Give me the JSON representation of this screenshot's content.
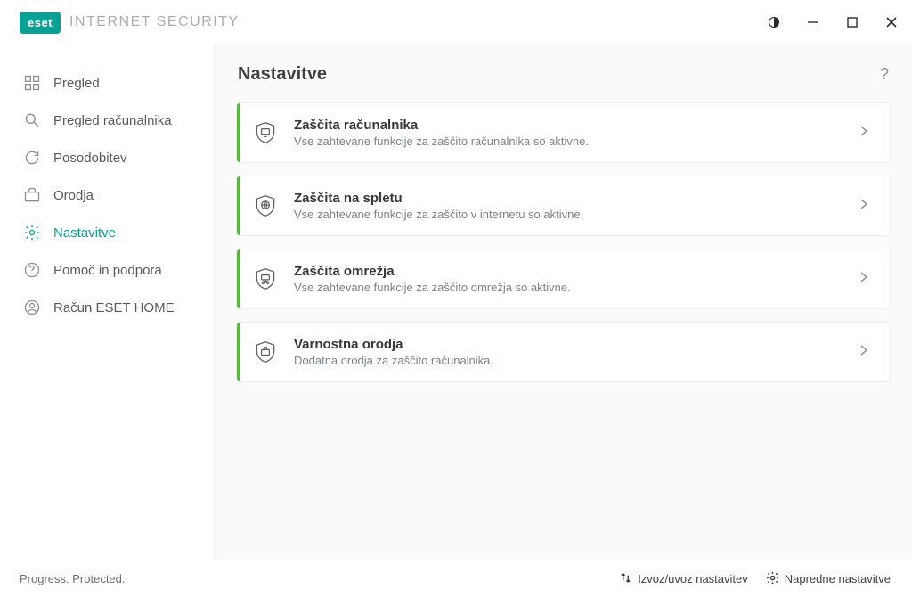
{
  "app": {
    "badge": "eset",
    "product": "INTERNET SECURITY",
    "tagline": "Progress. Protected."
  },
  "sidebar": {
    "items": [
      {
        "label": "Pregled",
        "active": false
      },
      {
        "label": "Pregled računalnika",
        "active": false
      },
      {
        "label": "Posodobitev",
        "active": false
      },
      {
        "label": "Orodja",
        "active": false
      },
      {
        "label": "Nastavitve",
        "active": true
      },
      {
        "label": "Pomoč in podpora",
        "active": false
      },
      {
        "label": "Račun ESET HOME",
        "active": false
      }
    ]
  },
  "page": {
    "title": "Nastavitve",
    "help_label": "?"
  },
  "cards": [
    {
      "title": "Zaščita računalnika",
      "subtitle": "Vse zahtevane funkcije za zaščito računalnika so aktivne."
    },
    {
      "title": "Zaščita na spletu",
      "subtitle": "Vse zahtevane funkcije za zaščito v internetu so aktivne."
    },
    {
      "title": "Zaščita omrežja",
      "subtitle": "Vse zahtevane funkcije za zaščito omrežja so aktivne."
    },
    {
      "title": "Varnostna orodja",
      "subtitle": "Dodatna orodja za zaščito računalnika."
    }
  ],
  "footer": {
    "import_export": "Izvoz/uvoz nastavitev",
    "advanced": "Napredne nastavitve"
  }
}
